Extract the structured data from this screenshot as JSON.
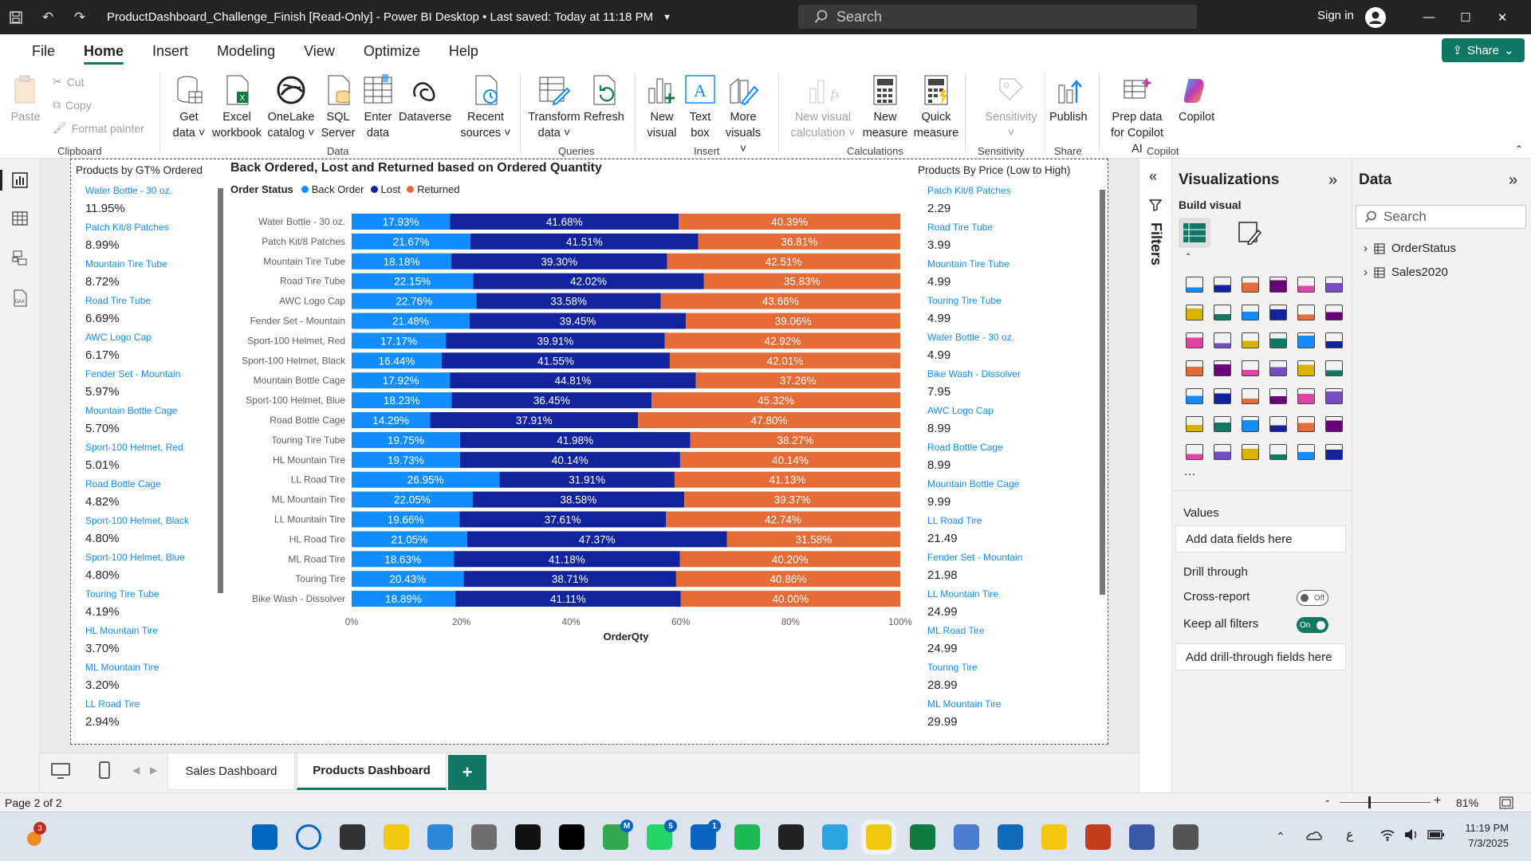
{
  "window": {
    "title": "ProductDashboard_Challenge_Finish [Read-Only] - Power BI Desktop • Last saved: Today at 11:18 PM",
    "search_placeholder": "Search",
    "signin_label": "Sign in"
  },
  "menu": {
    "tabs": [
      "File",
      "Home",
      "Insert",
      "Modeling",
      "View",
      "Optimize",
      "Help"
    ],
    "active": "Home",
    "share_label": "Share"
  },
  "ribbon": {
    "clipboard": {
      "paste": "Paste",
      "cut": "Cut",
      "copy": "Copy",
      "format_painter": "Format painter",
      "label": "Clipboard"
    },
    "data": {
      "get_data": "Get data ˅",
      "excel": "Excel workbook",
      "onelake": "OneLake catalog ˅",
      "sql": "SQL Server",
      "enter": "Enter data",
      "dataverse": "Dataverse",
      "recent": "Recent sources ˅",
      "label": "Data"
    },
    "queries": {
      "transform": "Transform data ˅",
      "refresh": "Refresh",
      "label": "Queries"
    },
    "insert": {
      "new_visual": "New visual",
      "text_box": "Text box",
      "more_visuals": "More visuals ˅",
      "label": "Insert"
    },
    "calculations": {
      "new_visual_calc": "New visual calculation ˅",
      "new_measure": "New measure",
      "quick_measure": "Quick measure",
      "label": "Calculations"
    },
    "sensitivity": {
      "sensitivity": "Sensitivity ˅",
      "label": "Sensitivity"
    },
    "share": {
      "publish": "Publish",
      "label": "Share"
    },
    "copilot": {
      "prep": "Prep data for Copilot AI",
      "copilot": "Copilot",
      "label": "Copilot"
    }
  },
  "left_slicer": {
    "title": "Products by GT% Ordered",
    "items": [
      {
        "name": "Water Bottle - 30 oz.",
        "value": "11.95%"
      },
      {
        "name": "Patch Kit/8 Patches",
        "value": "8.99%"
      },
      {
        "name": "Mountain Tire Tube",
        "value": "8.72%"
      },
      {
        "name": "Road Tire Tube",
        "value": "6.69%"
      },
      {
        "name": "AWC Logo Cap",
        "value": "6.17%"
      },
      {
        "name": "Fender Set - Mountain",
        "value": "5.97%"
      },
      {
        "name": "Mountain Bottle Cage",
        "value": "5.70%"
      },
      {
        "name": "Sport-100 Helmet, Red",
        "value": "5.01%"
      },
      {
        "name": "Road Bottle Cage",
        "value": "4.82%"
      },
      {
        "name": "Sport-100 Helmet, Black",
        "value": "4.80%"
      },
      {
        "name": "Sport-100 Helmet, Blue",
        "value": "4.80%"
      },
      {
        "name": "Touring Tire Tube",
        "value": "4.19%"
      },
      {
        "name": "HL Mountain Tire",
        "value": "3.70%"
      },
      {
        "name": "ML Mountain Tire",
        "value": "3.20%"
      },
      {
        "name": "LL Road Tire",
        "value": "2.94%"
      }
    ]
  },
  "right_slicer": {
    "title": "Products By Price (Low to High)",
    "items": [
      {
        "name": "Patch Kit/8 Patches",
        "value": "2.29"
      },
      {
        "name": "Road Tire Tube",
        "value": "3.99"
      },
      {
        "name": "Mountain Tire Tube",
        "value": "4.99"
      },
      {
        "name": "Touring Tire Tube",
        "value": "4.99"
      },
      {
        "name": "Water Bottle - 30 oz.",
        "value": "4.99"
      },
      {
        "name": "Bike Wash - Dissolver",
        "value": "7.95"
      },
      {
        "name": "AWC Logo Cap",
        "value": "8.99"
      },
      {
        "name": "Road Bottle Cage",
        "value": "8.99"
      },
      {
        "name": "Mountain Bottle Cage",
        "value": "9.99"
      },
      {
        "name": "LL Road Tire",
        "value": "21.49"
      },
      {
        "name": "Fender Set - Mountain",
        "value": "21.98"
      },
      {
        "name": "LL Mountain Tire",
        "value": "24.99"
      },
      {
        "name": "ML Road Tire",
        "value": "24.99"
      },
      {
        "name": "Touring Tire",
        "value": "28.99"
      },
      {
        "name": "ML Mountain Tire",
        "value": "29.99"
      }
    ]
  },
  "chart_data": {
    "type": "bar",
    "orientation": "horizontal",
    "stacked": "100%",
    "title": "Back Ordered, Lost and Returned based on Ordered Quantity",
    "legend_title": "Order Status",
    "legend_position": "top-left",
    "xlabel": "OrderQty",
    "ylabel": "",
    "xlim": [
      0,
      100
    ],
    "x_ticks": [
      "0%",
      "20%",
      "40%",
      "60%",
      "80%",
      "100%"
    ],
    "grid": false,
    "categories": [
      "Water Bottle - 30 oz.",
      "Patch Kit/8 Patches",
      "Mountain Tire Tube",
      "Road Tire Tube",
      "AWC Logo Cap",
      "Fender Set - Mountain",
      "Sport-100 Helmet, Red",
      "Sport-100 Helmet, Black",
      "Mountain Bottle Cage",
      "Sport-100 Helmet, Blue",
      "Road Bottle Cage",
      "Touring Tire Tube",
      "HL Mountain Tire",
      "LL Road Tire",
      "ML Mountain Tire",
      "LL Mountain Tire",
      "HL Road Tire",
      "ML Road Tire",
      "Touring Tire",
      "Bike Wash - Dissolver"
    ],
    "series": [
      {
        "name": "Back Order",
        "color": "#118dff",
        "values": [
          17.93,
          21.67,
          18.18,
          22.15,
          22.76,
          21.48,
          17.17,
          16.44,
          17.92,
          18.23,
          14.29,
          19.75,
          19.73,
          26.95,
          22.05,
          19.66,
          21.05,
          18.63,
          20.43,
          18.89
        ]
      },
      {
        "name": "Lost",
        "color": "#12239e",
        "values": [
          41.68,
          41.51,
          39.3,
          42.02,
          33.58,
          39.45,
          39.91,
          41.55,
          44.81,
          36.45,
          37.91,
          41.98,
          40.14,
          31.91,
          38.58,
          37.61,
          47.37,
          41.18,
          38.71,
          41.11
        ]
      },
      {
        "name": "Returned",
        "color": "#e66c37",
        "values": [
          40.39,
          36.81,
          42.51,
          35.83,
          43.66,
          39.06,
          42.92,
          42.01,
          37.26,
          45.32,
          47.8,
          38.27,
          40.14,
          41.13,
          39.37,
          42.74,
          31.58,
          40.2,
          40.86,
          40.0
        ]
      }
    ]
  },
  "filters_pane": {
    "label": "Filters"
  },
  "viz_pane": {
    "title": "Visualizations",
    "build_visual": "Build visual",
    "values_label": "Values",
    "add_data_fields": "Add data fields here",
    "drill_through": "Drill through",
    "cross_report": "Cross-report",
    "cross_report_state": "Off",
    "keep_filters": "Keep all filters",
    "keep_filters_state": "On",
    "add_drill_fields": "Add drill-through fields here",
    "more": "…"
  },
  "data_pane": {
    "title": "Data",
    "search_placeholder": "Search",
    "tables": [
      "OrderStatus",
      "Sales2020"
    ]
  },
  "page_tabs": {
    "tabs": [
      "Sales Dashboard",
      "Products Dashboard"
    ],
    "active": "Products Dashboard",
    "add": "+"
  },
  "status": {
    "page": "Page 2 of 2",
    "zoom": "81%",
    "minus": "-",
    "plus": "+"
  },
  "taskbar": {
    "time": "11:19 PM",
    "date": "7/3/2025",
    "notif_count": "3",
    "apps": [
      "start-icon",
      "search-icon",
      "task-view-icon",
      "file-explorer-icon",
      "store-icon",
      "calculator-icon",
      "netflix-icon",
      "tiktok-icon",
      "chrome-icon",
      "whatsapp-icon",
      "linkedin-icon",
      "spotify-icon",
      "chatgpt-icon",
      "telegram-icon",
      "powerbi-icon",
      "excel-icon",
      "notepad-icon",
      "outlook-icon",
      "folder-icon",
      "powerpoint-icon",
      "notes-icon",
      "camera-icon"
    ],
    "badges": {
      "chrome": "M",
      "whatsapp": "5",
      "linkedin": "1"
    },
    "lang": "ع"
  },
  "colors": {
    "accent": "#117865",
    "back_order": "#118dff",
    "lost": "#12239e",
    "returned": "#e66c37",
    "link": "#118dff"
  }
}
